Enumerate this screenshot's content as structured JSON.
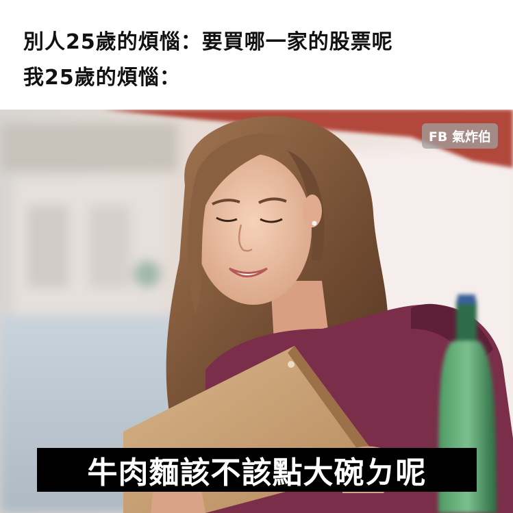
{
  "caption": {
    "line1": "別人25歲的煩惱：要買哪一家的股票呢",
    "line2": "我25歲的煩惱："
  },
  "watermark": "FB 氣炸伯",
  "subtitle": "牛肉麵該不該點大碗ㄉ呢",
  "colors": {
    "background": "#ffffff",
    "caption_text": "#111111",
    "subtitle_bg": "#000000",
    "subtitle_text": "#ffffff",
    "awning": "#b2473a",
    "dress": "#7a2e4a",
    "hair": "#7b5538",
    "menu": "#c9a06e",
    "bottle": "#2f7a4a"
  },
  "photo": {
    "description_icon": "woman-reading-menu-image"
  }
}
